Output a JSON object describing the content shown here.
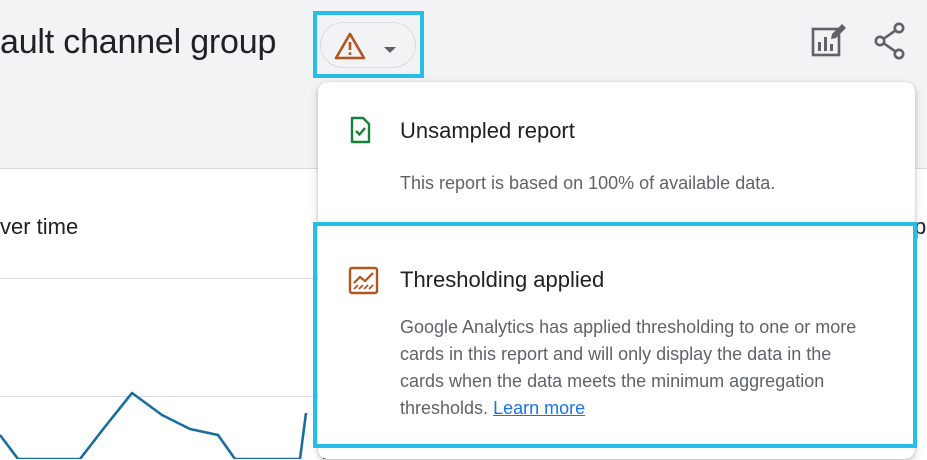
{
  "header": {
    "title": "ault channel group",
    "warning_icon": "warning-triangle-icon",
    "caret_icon": "caret-down-icon",
    "actions": [
      {
        "icon": "insights-edit-icon"
      },
      {
        "icon": "share-icon"
      }
    ]
  },
  "card": {
    "title": "ver time",
    "right_title": "p"
  },
  "popup": {
    "items": [
      {
        "icon": "unsampled-doc-check-icon",
        "title": "Unsampled report",
        "description": "This report is based on 100% of available data."
      },
      {
        "icon": "thresholding-chart-icon",
        "title": "Thresholding applied",
        "description": "Google Analytics has applied thresholding to one or more cards in this report and will only display the data in the cards when the data meets the minimum aggregation thresholds.",
        "link": "Learn more"
      }
    ]
  },
  "colors": {
    "warning": "#b3541e",
    "success": "#188038",
    "highlight": "#27bde9",
    "link": "#1a73e8",
    "chart_line": "#1a6e9e"
  }
}
